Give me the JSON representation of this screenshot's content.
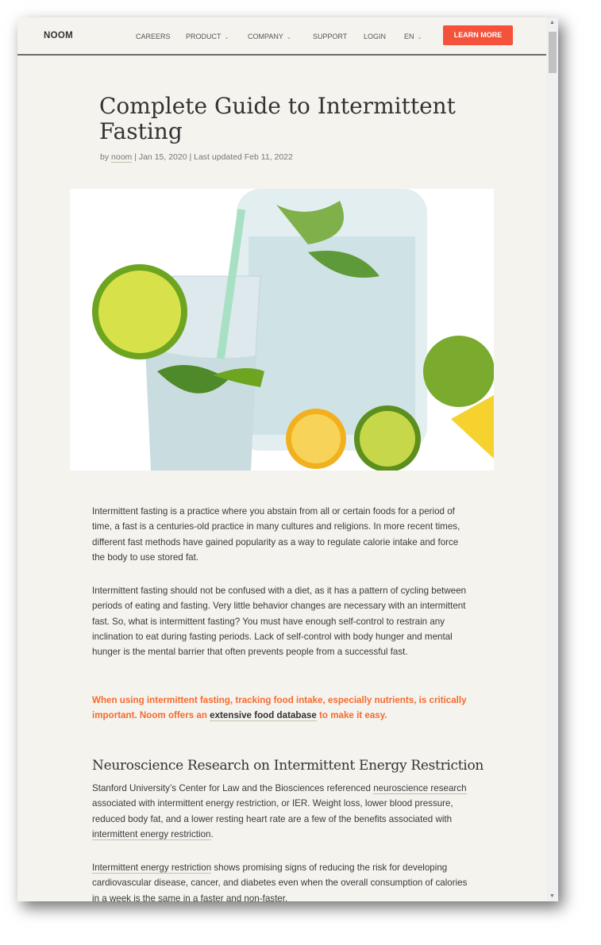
{
  "nav": {
    "logo": "NOOM",
    "items": [
      {
        "label": "CAREERS"
      },
      {
        "label": "PRODUCT"
      },
      {
        "label": "COMPANY"
      },
      {
        "label": "SUPPORT"
      },
      {
        "label": "LOGIN"
      },
      {
        "label": "EN"
      }
    ],
    "cta": "LEARN MORE",
    "chevron": "⌄"
  },
  "article": {
    "title": "Complete Guide to Intermittent Fasting",
    "byline": {
      "by": "by ",
      "author": "noom",
      "rest": " | Jan 15, 2020 | Last updated Feb 11, 2022"
    },
    "hero_alt": "glass of water with lime and mint",
    "p1": "Intermittent fasting is a practice where you abstain from all or certain foods for a period of time, a fast is a centuries-old practice in many cultures and religions. In more recent times, different fast methods have gained popularity as a way to regulate calorie intake and force the body to use stored fat.",
    "p2": "Intermittent fasting should not be confused with a diet, as it has a pattern of cycling between periods of eating and fasting. Very little behavior changes are necessary with an intermittent fast. So, what is intermittent fasting? You must have enough self-control to restrain any inclination to eat during fasting periods. Lack of self-control with body hunger and mental hunger is the mental barrier that often prevents people from a successful fast.",
    "callout": {
      "a": "When using intermittent fasting, tracking food intake, especially nutrients, is critically important. Noom offers an ",
      "link": "extensive food database",
      "b": " to make it easy."
    },
    "h2": "Neuroscience Research on Intermittent Energy Restriction",
    "p3": {
      "a": "Stanford University’s Center for Law and the Biosciences referenced ",
      "link1": "neuroscience research",
      "b": " associated with intermittent energy restriction, or IER. Weight loss, lower blood pressure, reduced body fat, and a lower resting heart rate are a few of the benefits associated with ",
      "link2": "intermittent energy restriction",
      "c": "."
    },
    "p4": {
      "link": "Intermittent energy restriction",
      "a": " shows promising signs of reducing the risk for developing cardiovascular disease, cancer, and diabetes even when the overall consumption of calories in a week is the same in a faster and non-faster."
    }
  },
  "colors": {
    "accent": "#f4523b",
    "callout": "#f56a2f",
    "background": "#f5f3ee"
  }
}
